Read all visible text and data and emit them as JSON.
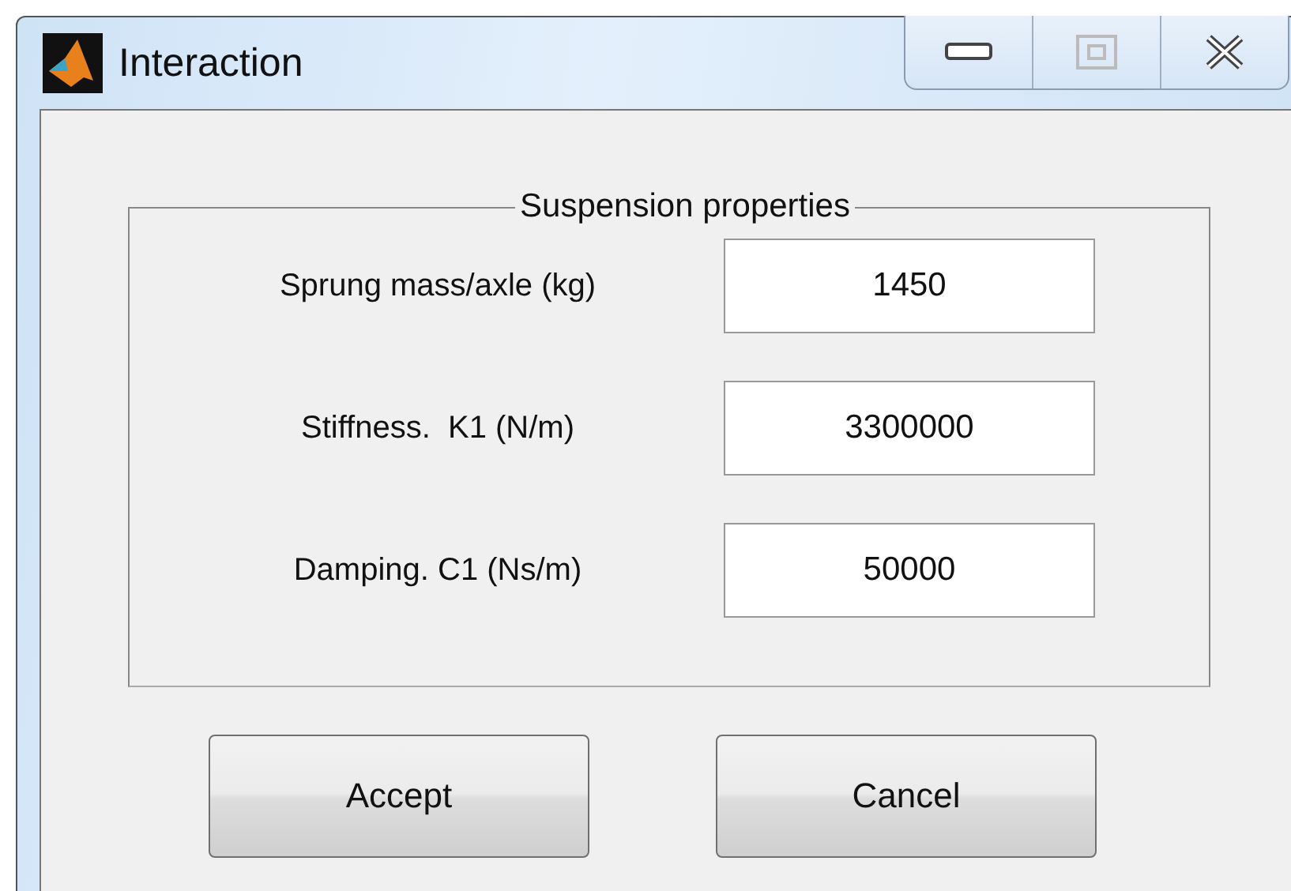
{
  "window": {
    "title": "Interaction"
  },
  "group": {
    "title": "Suspension properties"
  },
  "fields": [
    {
      "label": "Sprung mass/axle (kg)",
      "value": "1450"
    },
    {
      "label": "Stiffness.  K1 (N/m)",
      "value": "3300000"
    },
    {
      "label": "Damping. C1 (Ns/m)",
      "value": "50000"
    }
  ],
  "buttons": [
    {
      "label": "Accept"
    },
    {
      "label": "Cancel"
    }
  ]
}
